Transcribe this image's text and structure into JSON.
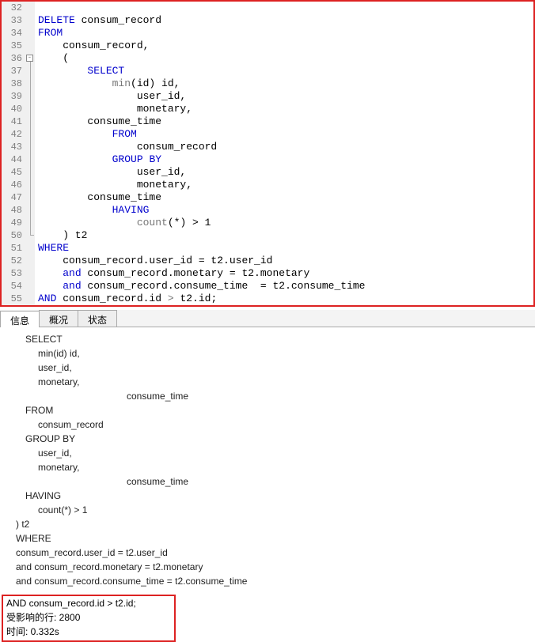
{
  "editor": {
    "lines": [
      {
        "n": 32,
        "fold": "",
        "html": ""
      },
      {
        "n": 33,
        "fold": "",
        "html": "<span class='kw'>DELETE</span> consum_record"
      },
      {
        "n": 34,
        "fold": "",
        "html": "<span class='kw'>FROM</span>"
      },
      {
        "n": 35,
        "fold": "",
        "html": "    consum_record,"
      },
      {
        "n": 36,
        "fold": "box",
        "html": "    ("
      },
      {
        "n": 37,
        "fold": "line",
        "html": "        <span class='kw'>SELECT</span>"
      },
      {
        "n": 38,
        "fold": "line",
        "html": "            <span class='gray'>min</span>(id) id,"
      },
      {
        "n": 39,
        "fold": "line",
        "html": "                user_id,"
      },
      {
        "n": 40,
        "fold": "line",
        "html": "                monetary,"
      },
      {
        "n": 41,
        "fold": "line",
        "html": "        consume_time"
      },
      {
        "n": 42,
        "fold": "line",
        "html": "            <span class='kw'>FROM</span>"
      },
      {
        "n": 43,
        "fold": "line",
        "html": "                consum_record"
      },
      {
        "n": 44,
        "fold": "line",
        "html": "            <span class='kw'>GROUP</span> <span class='kw'>BY</span>"
      },
      {
        "n": 45,
        "fold": "line",
        "html": "                user_id,"
      },
      {
        "n": 46,
        "fold": "line",
        "html": "                monetary,"
      },
      {
        "n": 47,
        "fold": "line",
        "html": "        consume_time"
      },
      {
        "n": 48,
        "fold": "line",
        "html": "            <span class='kw'>HAVING</span>"
      },
      {
        "n": 49,
        "fold": "line",
        "html": "                <span class='gray'>count</span>(*) &gt; 1"
      },
      {
        "n": 50,
        "fold": "end",
        "html": "    ) t2"
      },
      {
        "n": 51,
        "fold": "",
        "html": "<span class='kw'>WHERE</span>"
      },
      {
        "n": 52,
        "fold": "",
        "html": "    consum_record.user_id = t2.user_id"
      },
      {
        "n": 53,
        "fold": "",
        "html": "    <span class='kw'>and</span> consum_record.monetary = t2.monetary"
      },
      {
        "n": 54,
        "fold": "",
        "html": "    <span class='kw'>and</span> consum_record.consume_time  = t2.consume_time"
      },
      {
        "n": 55,
        "fold": "",
        "html": "<span class='kw'>AND</span> consum_record.id <span class='gray'>&gt;</span> t2.id;"
      }
    ]
  },
  "tabs": {
    "items": [
      "信息",
      "概况",
      "状态"
    ],
    "activeIndex": 0
  },
  "output": {
    "lines": [
      {
        "cls": "indent1",
        "text": "SELECT"
      },
      {
        "cls": "indent2",
        "text": "    min(id) id,"
      },
      {
        "cls": "indent2",
        "text": "user_id,"
      },
      {
        "cls": "indent2",
        "text": "monetary,"
      },
      {
        "cls": "indent3",
        "text": "consume_time"
      },
      {
        "cls": "indent1",
        "text": "FROM"
      },
      {
        "cls": "indent2",
        "text": "consum_record"
      },
      {
        "cls": "indent1",
        "text": "GROUP BY"
      },
      {
        "cls": "indent2",
        "text": "user_id,"
      },
      {
        "cls": "indent2",
        "text": "monetary,"
      },
      {
        "cls": "indent3",
        "text": "consume_time"
      },
      {
        "cls": "indent1",
        "text": "HAVING"
      },
      {
        "cls": "indent2",
        "text": "count(*) > 1"
      },
      {
        "cls": "",
        "text": "  ) t2"
      },
      {
        "cls": "",
        "text": "WHERE"
      },
      {
        "cls": "",
        "text": "  consum_record.user_id = t2.user_id"
      },
      {
        "cls": "",
        "text": "  and consum_record.monetary = t2.monetary"
      },
      {
        "cls": "",
        "text": "  and consum_record.consume_time  = t2.consume_time"
      }
    ],
    "result": [
      "AND consum_record.id > t2.id;",
      "受影响的行: 2800",
      "时间: 0.332s"
    ]
  }
}
